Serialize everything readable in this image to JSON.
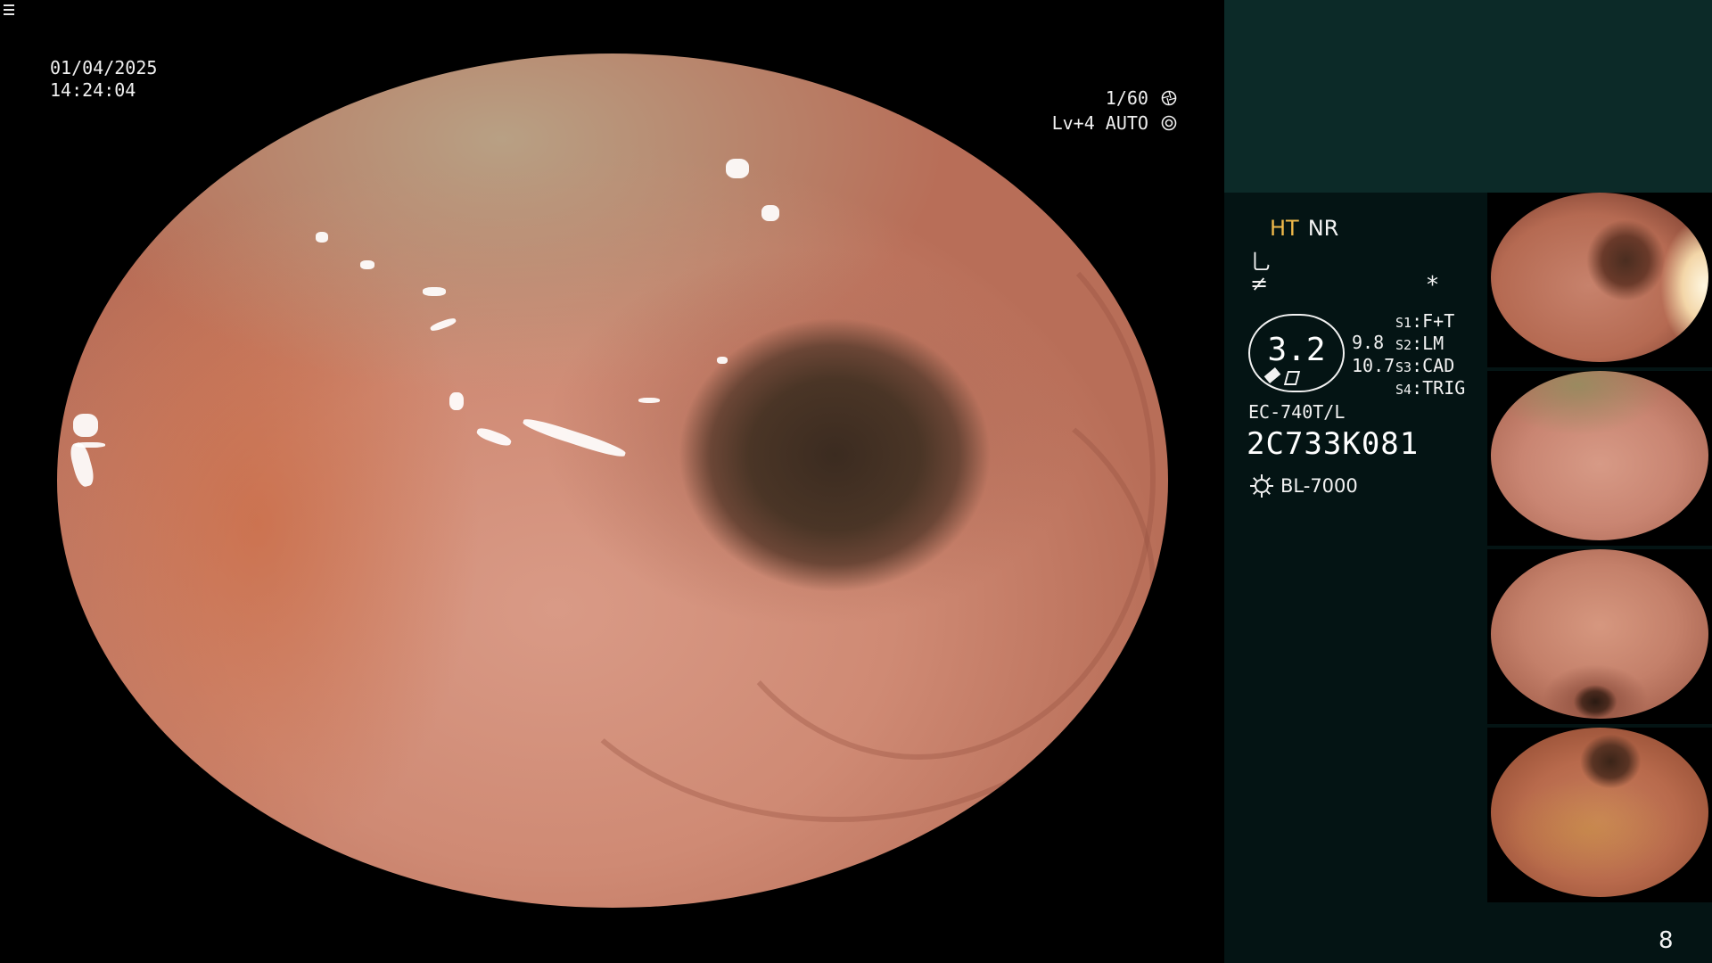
{
  "overlay": {
    "date": "01/04/2025",
    "time": "14:24:04",
    "shutter": "1/60",
    "shutter_icon": "iris-icon",
    "level": "Lv+4 AUTO",
    "level_icon": "auto-exposure-icon"
  },
  "panel": {
    "mode_primary": "HT",
    "mode_secondary": "NR",
    "mode_primary_color": "#f0b94a",
    "enhance_symbol": "⺃",
    "color_symbol": "≠",
    "asterisk": "*",
    "zoom": {
      "value": "3.2",
      "sub1": "9.8",
      "sub2": "10.7"
    },
    "slots": [
      {
        "key": "S1",
        "value": "F+T"
      },
      {
        "key": "S2",
        "value": "LM"
      },
      {
        "key": "S3",
        "value": "CAD"
      },
      {
        "key": "S4",
        "value": "TRIG"
      }
    ],
    "scope_model": "EC-740T/L",
    "scope_serial": "2C733K081",
    "light_source": "BL-7000",
    "page_number": "8"
  },
  "colors": {
    "panel_bg": "#041414",
    "panel_header_bg": "#0c2a28",
    "mucosa": "#d99a86",
    "lumen": "#3b2b20"
  }
}
